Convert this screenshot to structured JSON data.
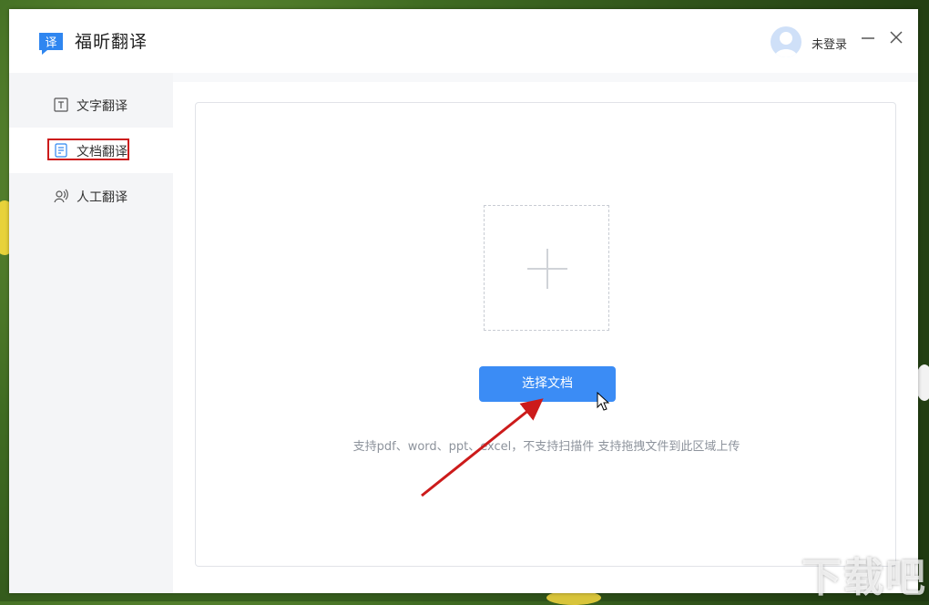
{
  "app": {
    "title": "福昕翻译",
    "logo_char": "译",
    "brand_color": "#2f86f0"
  },
  "header": {
    "login_text": "未登录",
    "minimize_icon": "minimize-icon",
    "close_icon": "close-icon"
  },
  "sidebar": {
    "items": [
      {
        "label": "文字翻译",
        "icon": "text-t-icon",
        "active": false
      },
      {
        "label": "文档翻译",
        "icon": "document-icon",
        "active": true
      },
      {
        "label": "人工翻译",
        "icon": "human-voice-icon",
        "active": false
      }
    ]
  },
  "main": {
    "dropzone_icon": "plus-icon",
    "select_button_label": "选择文档",
    "hint_text": "支持pdf、word、ppt、excel，不支持扫描件 支持拖拽文件到此区域上传",
    "accent_color": "#3b8cf5"
  },
  "annotation": {
    "highlight_color": "#cc1b1b",
    "arrow_color": "#cc1b1b"
  },
  "watermark": {
    "text": "下载吧",
    "url": "www.xiazaiba.com"
  }
}
